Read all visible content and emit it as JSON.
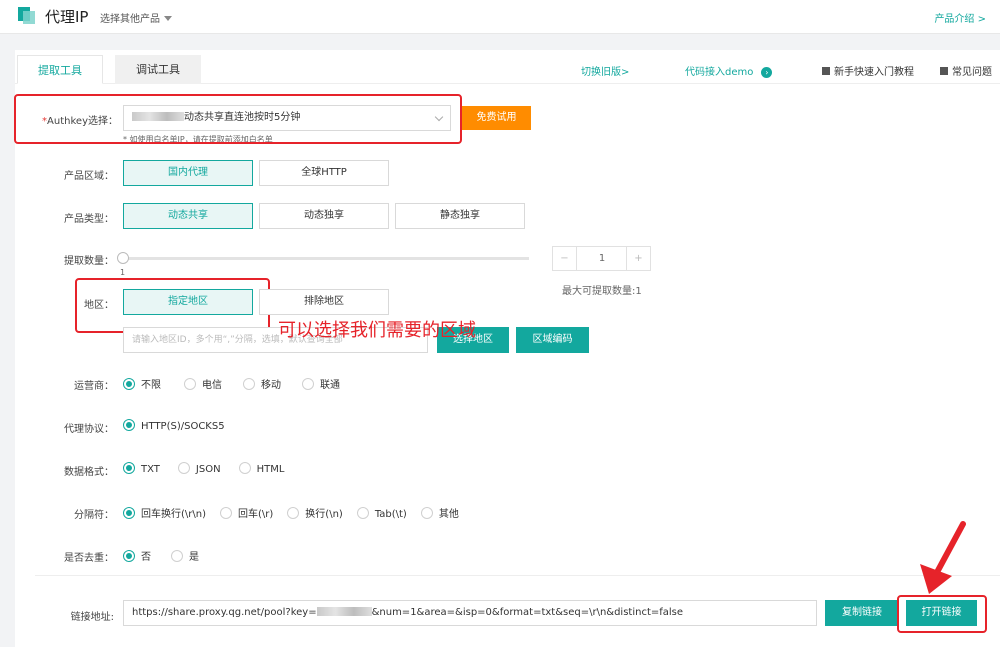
{
  "header": {
    "app_title": "代理IP",
    "product_select": "选择其他产品",
    "product_intro": "产品介绍 >"
  },
  "tabs": [
    {
      "label": "提取工具",
      "active": true
    },
    {
      "label": "调试工具",
      "active": false
    }
  ],
  "top_links": {
    "switch_old": "切换旧版>",
    "code_demo": "代码接入demo",
    "beginner": "新手快速入门教程",
    "faq": "常见问题"
  },
  "authkey": {
    "label_required": "*",
    "label": "Authkey选择：",
    "selected_suffix": "动态共享直连池按时5分钟",
    "hint": "* 如使用白名单IP，请在提取前添加白名单",
    "trial_button": "免费试用"
  },
  "product_region": {
    "label": "产品区域：",
    "options": [
      "国内代理",
      "全球HTTP"
    ],
    "selected": "国内代理"
  },
  "product_type": {
    "label": "产品类型：",
    "options": [
      "动态共享",
      "动态独享",
      "静态独享"
    ],
    "selected": "动态共享"
  },
  "quantity": {
    "label": "提取数量：",
    "slider_value": "1",
    "stepper_minus": "−",
    "stepper_value": "1",
    "stepper_plus": "+",
    "max_note": "最大可提取数量:1"
  },
  "region": {
    "label": "地区：",
    "options": [
      "指定地区",
      "排除地区"
    ],
    "selected": "指定地区",
    "annotation": "可以选择我们需要的区域",
    "input_placeholder": "请输入地区ID，多个用“,”分隔，选填，默认查询全部",
    "select_button": "选择地区",
    "code_button": "区域编码"
  },
  "isp": {
    "label": "运营商：",
    "options": [
      "不限",
      "电信",
      "移动",
      "联通"
    ],
    "selected": "不限"
  },
  "protocol": {
    "label": "代理协议：",
    "options": [
      "HTTP(S)/SOCKS5"
    ],
    "selected": "HTTP(S)/SOCKS5"
  },
  "format": {
    "label": "数据格式：",
    "options": [
      "TXT",
      "JSON",
      "HTML"
    ],
    "selected": "TXT"
  },
  "separator": {
    "label": "分隔符：",
    "options": [
      "回车换行(\\r\\n)",
      "回车(\\r)",
      "换行(\\n)",
      "Tab(\\t)",
      "其他"
    ],
    "selected": "回车换行(\\r\\n)"
  },
  "dedupe": {
    "label": "是否去重：",
    "options": [
      "否",
      "是"
    ],
    "selected": "否"
  },
  "link": {
    "label": "链接地址:",
    "url_prefix": "https://share.proxy.qg.net/pool?key=",
    "url_suffix": "&num=1&area=&isp=0&format=txt&seq=\\r\\n&distinct=false",
    "copy_button": "复制链接",
    "open_button": "打开链接"
  },
  "colors": {
    "accent": "#13a89e",
    "orange": "#ff8c00",
    "annotation_red": "#e6232a"
  }
}
